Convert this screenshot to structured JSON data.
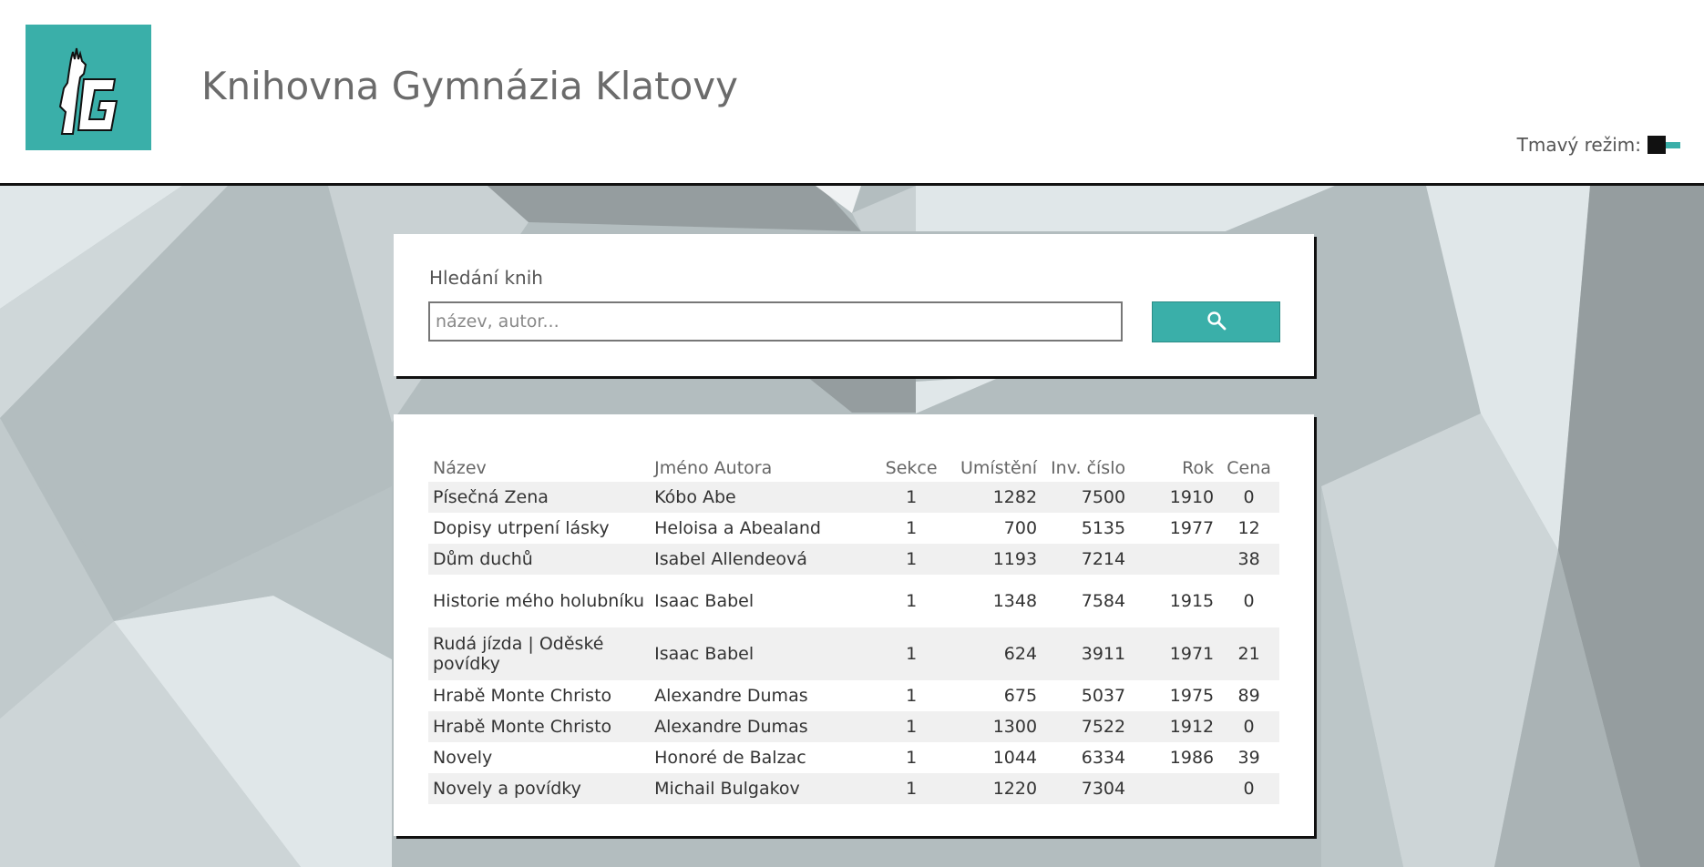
{
  "header": {
    "site_title": "Knihovna Gymnázia Klatovy",
    "logo_icon": "castle-g-logo",
    "dark_mode_label": "Tmavý režim:",
    "dark_mode_on": false
  },
  "colors": {
    "accent": "#3aafa9",
    "header_bg": "#ffffff",
    "card_shadow": "#111111"
  },
  "search": {
    "heading": "Hledání knih",
    "placeholder": "název, autor...",
    "value": "",
    "button_icon": "search-icon"
  },
  "table": {
    "columns": [
      "Název",
      "Jméno Autora",
      "Sekce",
      "Umístění",
      "Inv. číslo",
      "Rok",
      "Cena"
    ],
    "rows": [
      [
        "Písečná Zena",
        "Kóbo Abe",
        "1",
        "1282",
        "7500",
        "1910",
        "0"
      ],
      [
        "Dopisy utrpení lásky",
        "Heloisa a Abealand",
        "1",
        "700",
        "5135",
        "1977",
        "12"
      ],
      [
        "Dům duchů",
        "Isabel Allendeová",
        "1",
        "1193",
        "7214",
        "",
        "38"
      ],
      [
        "Historie mého holubníku",
        "Isaac Babel",
        "1",
        "1348",
        "7584",
        "1915",
        "0"
      ],
      [
        "Rudá jízda | Oděské povídky",
        "Isaac Babel",
        "1",
        "624",
        "3911",
        "1971",
        "21"
      ],
      [
        "Hrabě Monte Christo",
        "Alexandre Dumas",
        "1",
        "675",
        "5037",
        "1975",
        "89"
      ],
      [
        "Hrabě Monte Christo",
        "Alexandre Dumas",
        "1",
        "1300",
        "7522",
        "1912",
        "0"
      ],
      [
        "Novely",
        "Honoré de Balzac",
        "1",
        "1044",
        "6334",
        "1986",
        "39"
      ],
      [
        "Novely a povídky",
        "Michail Bulgakov",
        "1",
        "1220",
        "7304",
        "",
        "0"
      ]
    ]
  }
}
